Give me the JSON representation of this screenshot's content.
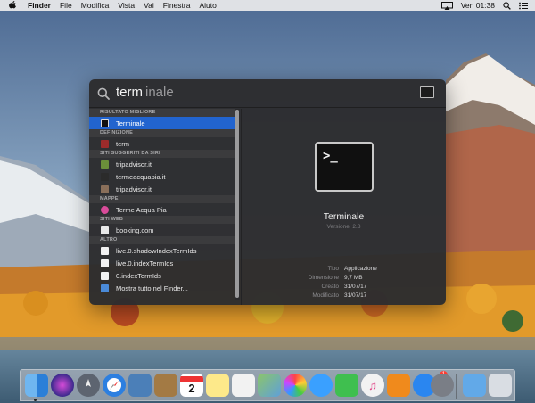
{
  "menubar": {
    "app_name": "Finder",
    "items": [
      "File",
      "Modifica",
      "Vista",
      "Vai",
      "Finestra",
      "Aiuto"
    ],
    "clock": "Ven 01:38"
  },
  "spotlight": {
    "query_typed": "term",
    "query_completion": "inale",
    "groups": [
      {
        "header": "RISULTATO MIGLIORE",
        "rows": [
          {
            "label": "Terminale",
            "icon": "terminal-icon",
            "selected": true
          }
        ]
      },
      {
        "header": "DEFINIZIONE",
        "rows": [
          {
            "label": "term",
            "icon": "dictionary-icon"
          }
        ]
      },
      {
        "header": "SITI SUGGERITI DA SIRI",
        "rows": [
          {
            "label": "tripadvisor.it",
            "icon": "tripadvisor-icon"
          },
          {
            "label": "termeacquapia.it",
            "icon": "globe-icon"
          },
          {
            "label": "tripadvisor.it",
            "icon": "tripadvisor-icon"
          }
        ]
      },
      {
        "header": "MAPPE",
        "rows": [
          {
            "label": "Terme Acqua Pia",
            "icon": "map-pin-icon"
          }
        ]
      },
      {
        "header": "SITI WEB",
        "rows": [
          {
            "label": "booking.com",
            "icon": "booking-icon"
          }
        ]
      },
      {
        "header": "ALTRO",
        "rows": [
          {
            "label": "live.0.shadowIndexTermIds",
            "icon": "document-icon"
          },
          {
            "label": "live.0.indexTermIds",
            "icon": "document-icon"
          },
          {
            "label": "0.indexTermIds",
            "icon": "document-icon"
          },
          {
            "label": "Mostra tutto nel Finder...",
            "icon": "finder-icon"
          }
        ]
      }
    ],
    "preview": {
      "icon_text": ">_",
      "name": "Terminale",
      "version": "Versione: 2.8",
      "meta": [
        {
          "key": "Tipo",
          "value": "Applicazione"
        },
        {
          "key": "Dimensione",
          "value": "9,7 MB"
        },
        {
          "key": "Creato",
          "value": "31/07/17"
        },
        {
          "key": "Modificato",
          "value": "31/07/17"
        }
      ]
    }
  },
  "dock": {
    "items": [
      "Finder",
      "Siri",
      "Launchpad",
      "Safari",
      "Foto",
      "Contatti",
      "Calendario",
      "Note",
      "Promemoria",
      "Mappe",
      "Foto",
      "Messaggi",
      "FaceTime",
      "iTunes",
      "iBooks",
      "App Store",
      "Preferenze di Sistema",
      "Download",
      "Cestino"
    ],
    "calendar_day": "2",
    "app_store_badge": "1"
  }
}
